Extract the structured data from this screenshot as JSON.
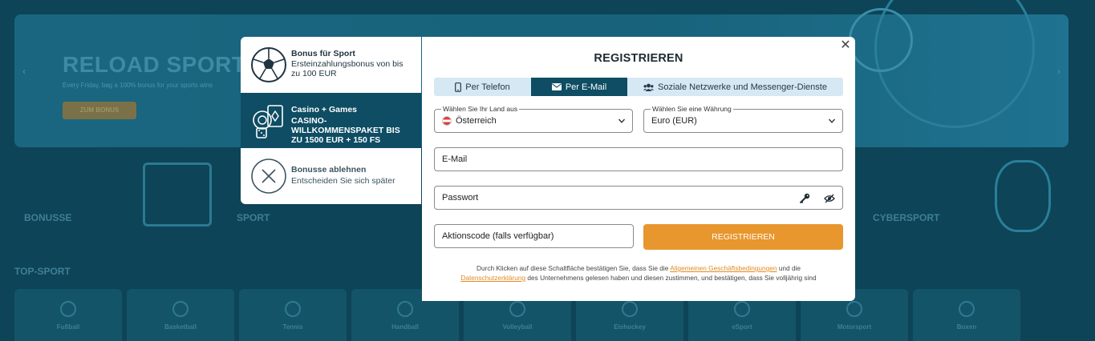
{
  "background": {
    "banner_title": "RELOAD SPORT",
    "banner_subtitle": "Every Friday, bag a 100% bonus for your sports wins",
    "banner_button": "ZUM BONUS",
    "categories": [
      "BONUSSE",
      "SPORT",
      "CYBERSPORT"
    ],
    "section_title": "TOP-SPORT",
    "sports": [
      "Fußball",
      "Basketball",
      "Tennis",
      "Handball",
      "Volleyball",
      "Eishockey",
      "eSport",
      "Motorsport",
      "Boxen"
    ]
  },
  "bonus_panel": {
    "items": [
      {
        "title": "Bonus für Sport",
        "text": "Ersteinzahlungsbonus von bis zu 100 EUR",
        "icon": "soccer-ball-icon",
        "selected": false
      },
      {
        "title": "Casino + Games",
        "text": "CASINO-WILLKOMMENSPAKET BIS ZU 1500 EUR + 150 FS",
        "icon": "casino-chips-icon",
        "selected": true
      },
      {
        "title": "Bonusse ablehnen",
        "text": "Entscheiden Sie sich später",
        "icon": "decline-x-icon",
        "selected": false
      }
    ]
  },
  "modal": {
    "title": "REGISTRIEREN",
    "close_label": "✕",
    "tabs": [
      {
        "label": "Per Telefon",
        "icon": "phone-icon",
        "active": false
      },
      {
        "label": "Per E-Mail",
        "icon": "envelope-icon",
        "active": true
      },
      {
        "label": "Soziale Netzwerke und Messenger-Dienste",
        "icon": "users-icon",
        "active": false
      }
    ],
    "country": {
      "label": "Wählen Sie Ihr Land aus",
      "value": "Österreich"
    },
    "currency": {
      "label": "Wählen Sie eine Währung",
      "value": "Euro (EUR)"
    },
    "email": {
      "placeholder": "E-Mail",
      "value": ""
    },
    "password": {
      "placeholder": "Passwort",
      "value": ""
    },
    "promo": {
      "placeholder": "Aktionscode (falls verfügbar)",
      "value": ""
    },
    "submit_label": "REGISTRIEREN",
    "legal": {
      "part1": "Durch Klicken auf diese Schaltfläche bestätigen Sie, dass Sie die",
      "link1": "Allgemeinen Geschäftsbedingungen",
      "part2": "und die",
      "link2": "Datenschutzerklärung",
      "part3": "des Unternehmens gelesen haben und diesen zustimmen, und bestätigen, dass Sie volljährig sind"
    }
  },
  "colors": {
    "accent_orange": "#e8962e",
    "active_teal": "#0e4d63",
    "tab_bar": "#d6e8f3",
    "link_orange": "#e28b22"
  }
}
